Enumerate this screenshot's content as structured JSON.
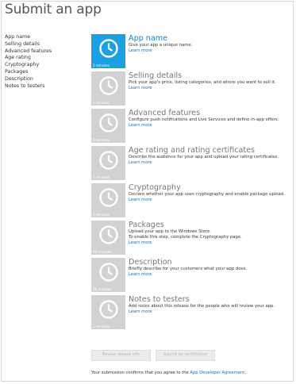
{
  "header": {
    "title": "Submit an app"
  },
  "sidebar": {
    "items": [
      "App name",
      "Selling details",
      "Advanced features",
      "Age rating",
      "Cryptography",
      "Packages",
      "Description",
      "Notes to testers"
    ]
  },
  "steps": [
    {
      "title": "App name",
      "description": "Give your app a unique name.",
      "link": "Learn more",
      "duration": "2 minutes"
    },
    {
      "title": "Selling details",
      "description": "Pick your app's price, listing categories, and where you want to sell it.",
      "link": "Learn more",
      "duration": "5 minutes"
    },
    {
      "title": "Advanced features",
      "description": "Configure push notifications and Live Services and define in-app offers.",
      "link": "Learn more",
      "duration": "5 minutes"
    },
    {
      "title": "Age rating and rating certificates",
      "description": "Describe the audience for your app and upload your rating certificates.",
      "link": "Learn more",
      "duration": "5 minutes"
    },
    {
      "title": "Cryptography",
      "description": "Declare whether your app uses cryptography and enable package upload.",
      "link": "Learn more",
      "duration": "5 minutes"
    },
    {
      "title": "Packages",
      "description": "Upload your app to the Windows Store.",
      "description2": "To enable this step, complete the Cryptography page.",
      "link": "Learn more",
      "duration": "30 minutes"
    },
    {
      "title": "Description",
      "description": "Briefly describe for your customers what your app does.",
      "link": "Learn more",
      "duration": "30 minutes"
    },
    {
      "title": "Notes to testers",
      "description": "Add notes about this release for the people who will review your app.",
      "link": "Learn more",
      "duration": "2 minutes"
    }
  ],
  "actions": {
    "review_label": "Review release info",
    "submit_label": "Submit for certification"
  },
  "footer": {
    "agreement_prefix": "Your submission confirms that you agree to the ",
    "agreement_link": "App Developer Agreement",
    "agreement_suffix": "."
  },
  "colors": {
    "accent": "#1ba1e2",
    "tile_inactive": "#d2d2d2",
    "link": "#1b6fb5"
  },
  "icons": {
    "step_tile": "clock-icon"
  }
}
